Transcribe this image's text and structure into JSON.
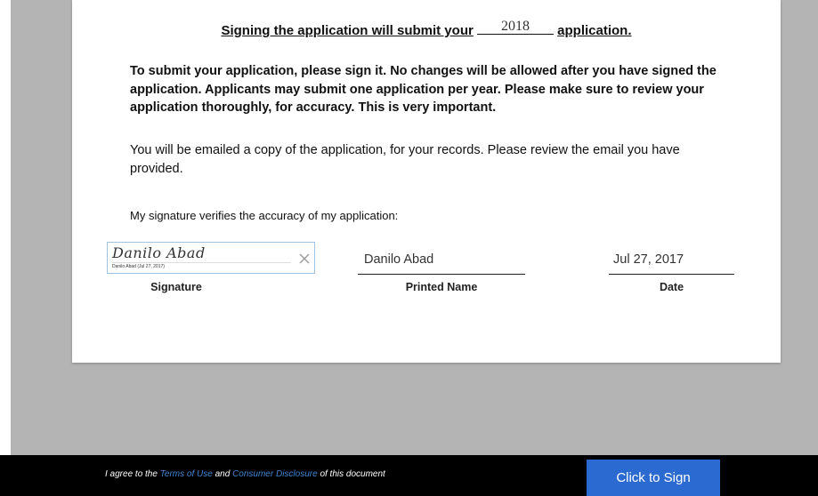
{
  "document": {
    "heading_prefix": "Signing the application will submit your",
    "heading_year": "2018",
    "heading_suffix": "application.",
    "paragraph_bold": "To submit your application, please sign it. No changes will be allowed after you have signed the application. Applicants may submit one application per year. Please make sure to review your application thoroughly, for accuracy. This is very important.",
    "paragraph_info": "You will be emailed a copy of the application, for your records. Please review the email you have provided.",
    "verify_text": "My signature verifies the accuracy of my application:",
    "signature": {
      "script_text": "Danilo Abad",
      "stamp_text": "Danilo Abad   (Jul 27, 2017)",
      "label": "Signature",
      "clear_icon": "close-icon"
    },
    "printed_name": {
      "value": "Danilo Abad",
      "label": "Printed Name"
    },
    "date": {
      "value": "Jul 27, 2017",
      "label": "Date"
    }
  },
  "footer": {
    "agree_prefix": "I agree to the",
    "terms_link": "Terms of Use",
    "and_text": "and",
    "disclosure_link": "Consumer Disclosure",
    "agree_suffix": "of this document",
    "sign_button": "Click to Sign"
  },
  "colors": {
    "footer_bg": "#000000",
    "sign_button": "#2b6ad0",
    "link": "#3f86d6",
    "viewer_bg": "#b4b4b4"
  }
}
